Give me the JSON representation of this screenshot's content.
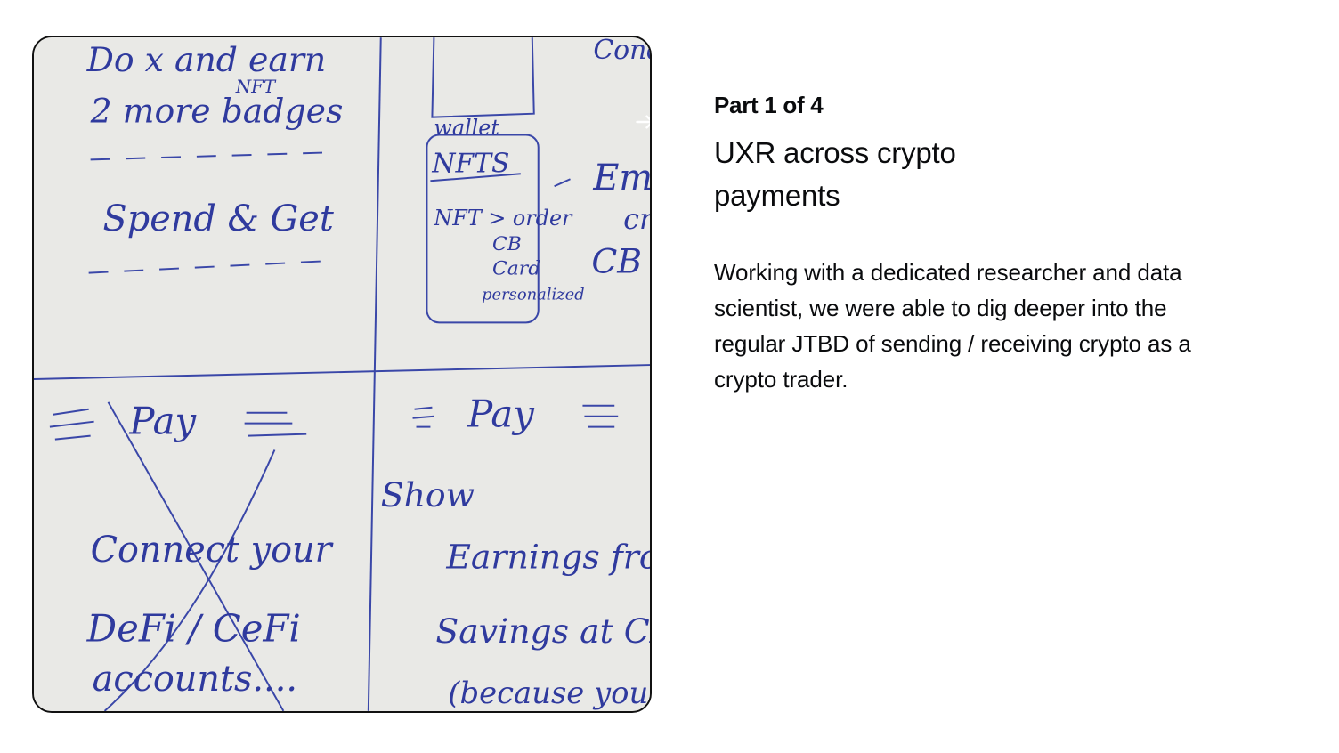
{
  "card": {
    "image_alt": "Whiteboard sketch of crypto payments concepts",
    "next_arrow_icon": "arrow-right-icon"
  },
  "sketch": {
    "q1_line1": "Do  x  and earn",
    "q1_nft": "NFT",
    "q1_line2": "2 more badges",
    "q1_line3": "Spend & Get",
    "q2_wallet": "wallet",
    "q2_nfts": "NFTS",
    "q2_nft_order": "NFT > order",
    "q2_cb": "CB",
    "q2_card": "Card",
    "q2_personalized": "personalized",
    "q2_em": "Em",
    "q2_cr": "cr",
    "q2_cb2": "CB c",
    "q2_top": "Cond",
    "q3_pay": "Pay",
    "q3_connect": "Connect your",
    "q3_defi": "DeFi / CeFi",
    "q3_accounts": "accounts....",
    "q4_pay": "Pay",
    "q4_show": "Show",
    "q4_earnings": "Earnings from CB",
    "q4_savings": "Savings at CB",
    "q4_because": "(because you"
  },
  "content": {
    "eyebrow": "Part 1 of 4",
    "heading": "UXR across crypto payments",
    "body": "Working with a dedicated researcher and data scientist, we were able to dig deeper into the regular JTBD of sending / receiving crypto as a crypto trader."
  },
  "colors": {
    "ink": "#2f3a9e",
    "paper": "#e9e9e6",
    "text": "#0a0b0d"
  }
}
